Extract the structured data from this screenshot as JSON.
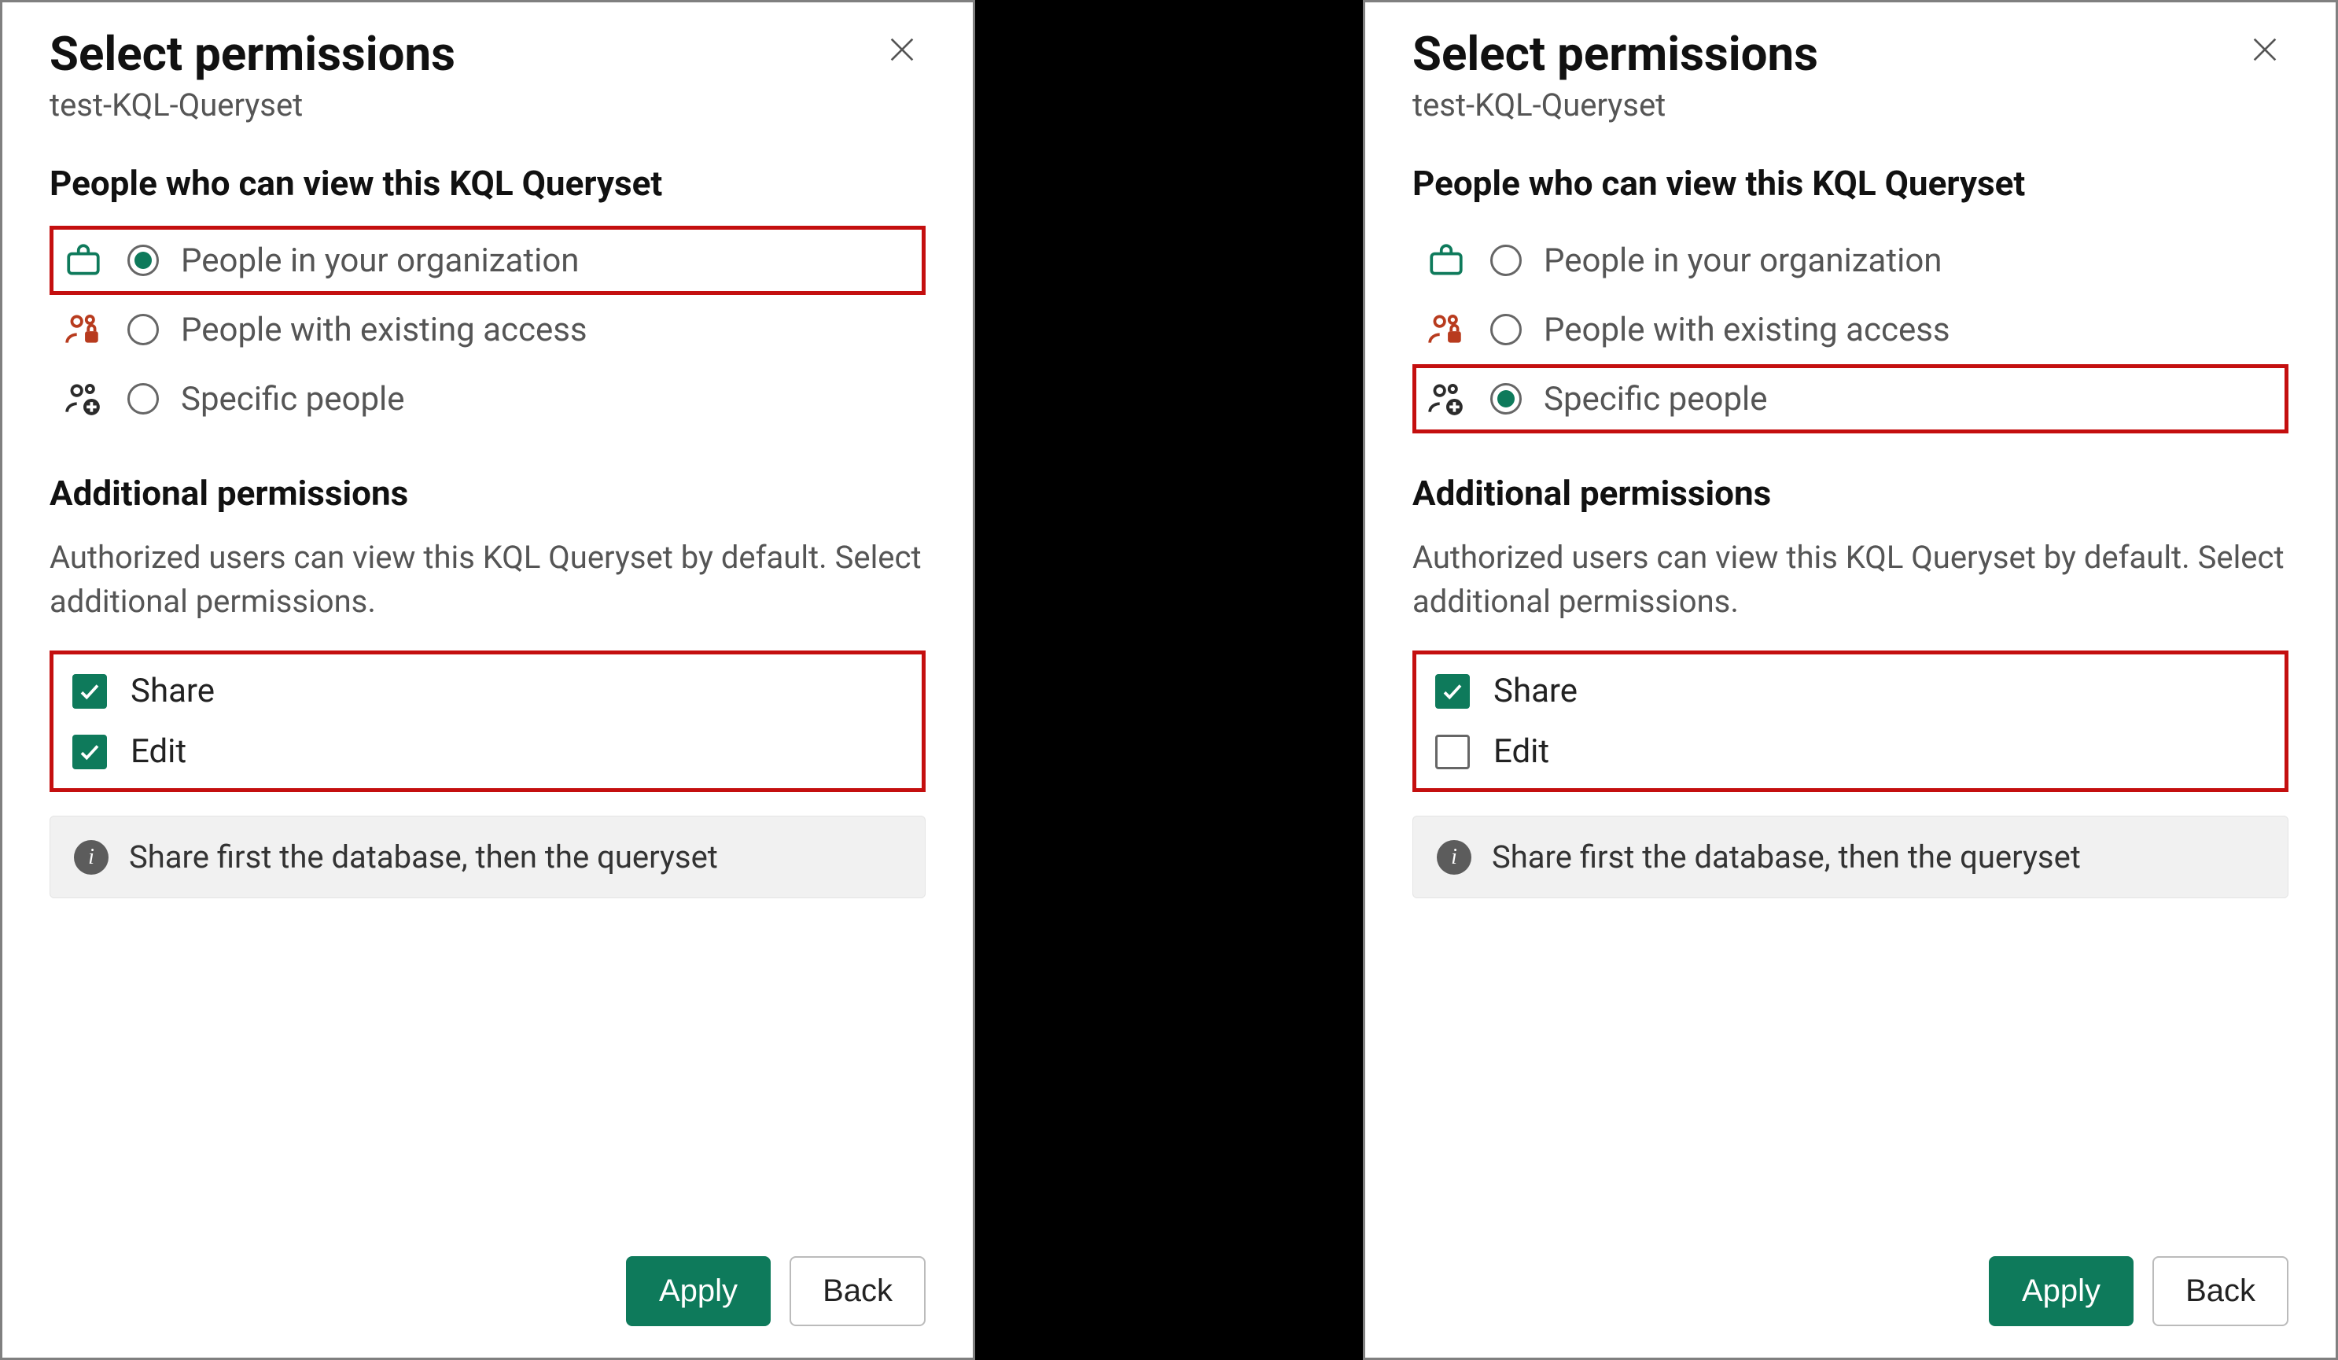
{
  "left": {
    "title": "Select permissions",
    "subtitle": "test-KQL-Queryset",
    "section_people": "People who can view this KQL Queryset",
    "options": [
      {
        "label": "People in your organization",
        "checked": true,
        "highlight": true
      },
      {
        "label": "People with existing access",
        "checked": false,
        "highlight": false
      },
      {
        "label": "Specific people",
        "checked": false,
        "highlight": false
      }
    ],
    "section_additional": "Additional permissions",
    "additional_desc": "Authorized users can view this KQL Queryset by default. Select additional permissions.",
    "checks_highlight": true,
    "checks": [
      {
        "label": "Share",
        "checked": true
      },
      {
        "label": "Edit",
        "checked": true
      }
    ],
    "info": "Share first the database, then the queryset",
    "apply": "Apply",
    "back": "Back"
  },
  "right": {
    "title": "Select permissions",
    "subtitle": "test-KQL-Queryset",
    "section_people": "People who can view this KQL Queryset",
    "options": [
      {
        "label": "People in your organization",
        "checked": false,
        "highlight": false
      },
      {
        "label": "People with existing access",
        "checked": false,
        "highlight": false
      },
      {
        "label": "Specific people",
        "checked": true,
        "highlight": true
      }
    ],
    "section_additional": "Additional permissions",
    "additional_desc": "Authorized users can view this KQL Queryset by default. Select additional permissions.",
    "checks_highlight": true,
    "checks": [
      {
        "label": "Share",
        "checked": true
      },
      {
        "label": "Edit",
        "checked": false
      }
    ],
    "info": "Share first the database, then the queryset",
    "apply": "Apply",
    "back": "Back"
  }
}
